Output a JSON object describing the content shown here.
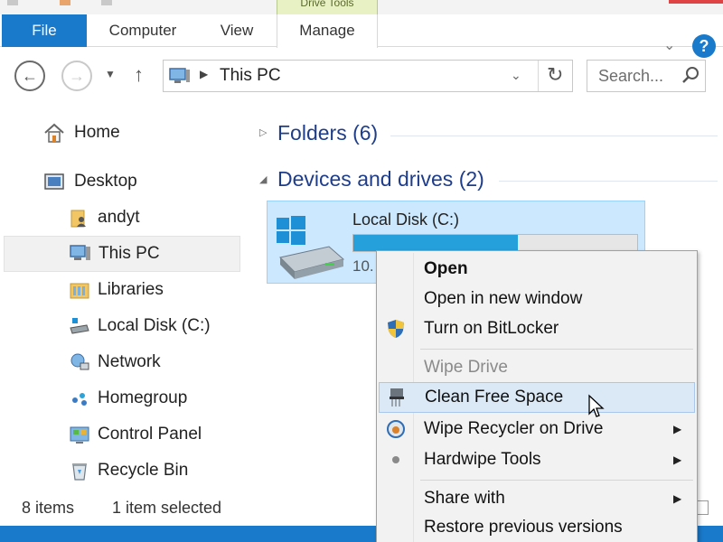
{
  "title_bar": {
    "contextual_tab_group": "Drive Tools"
  },
  "ribbon": {
    "tabs": [
      {
        "label": "File"
      },
      {
        "label": "Computer"
      },
      {
        "label": "View"
      },
      {
        "label": "Manage"
      }
    ],
    "help_label": "?"
  },
  "address": {
    "path": "This PC",
    "search_placeholder": "Search..."
  },
  "nav_pane": {
    "items": [
      {
        "label": "Home",
        "icon": "home-icon"
      },
      {
        "label": "Desktop",
        "icon": "desktop-icon"
      },
      {
        "label": "andyt",
        "icon": "user-folder-icon"
      },
      {
        "label": "This PC",
        "icon": "computer-icon",
        "selected": true
      },
      {
        "label": "Libraries",
        "icon": "libraries-icon"
      },
      {
        "label": "Local Disk (C:)",
        "icon": "drive-icon"
      },
      {
        "label": "Network",
        "icon": "network-icon"
      },
      {
        "label": "Homegroup",
        "icon": "homegroup-icon"
      },
      {
        "label": "Control Panel",
        "icon": "control-panel-icon"
      },
      {
        "label": "Recycle Bin",
        "icon": "recycle-bin-icon"
      }
    ]
  },
  "content": {
    "groups": [
      {
        "label": "Folders (6)",
        "expanded": false
      },
      {
        "label": "Devices and drives (2)",
        "expanded": true
      }
    ],
    "drive": {
      "name": "Local Disk (C:)",
      "free_text": "10.",
      "used_fraction": 0.58
    }
  },
  "status_bar": {
    "item_count": "8 items",
    "selection": "1 item selected"
  },
  "context_menu": {
    "items": [
      {
        "label": "Open",
        "bold": true
      },
      {
        "label": "Open in new window"
      },
      {
        "label": "Turn on BitLocker",
        "icon": "shield-icon"
      },
      {
        "label": "Wipe Drive",
        "disabled": true
      },
      {
        "label": "Clean Free Space",
        "icon": "shredder-icon",
        "hover": true
      },
      {
        "label": "Wipe Recycler on Drive",
        "icon": "recycler-wipe-icon",
        "submenu": true
      },
      {
        "label": "Hardwipe Tools",
        "icon": "bullet-icon",
        "submenu": true
      },
      {
        "label": "Share with",
        "submenu": true
      },
      {
        "label": "Restore previous versions"
      }
    ]
  },
  "colors": {
    "accent": "#1979ca",
    "group_header": "#1e3d8a",
    "selection": "#cce8ff",
    "progress": "#26a0da"
  }
}
